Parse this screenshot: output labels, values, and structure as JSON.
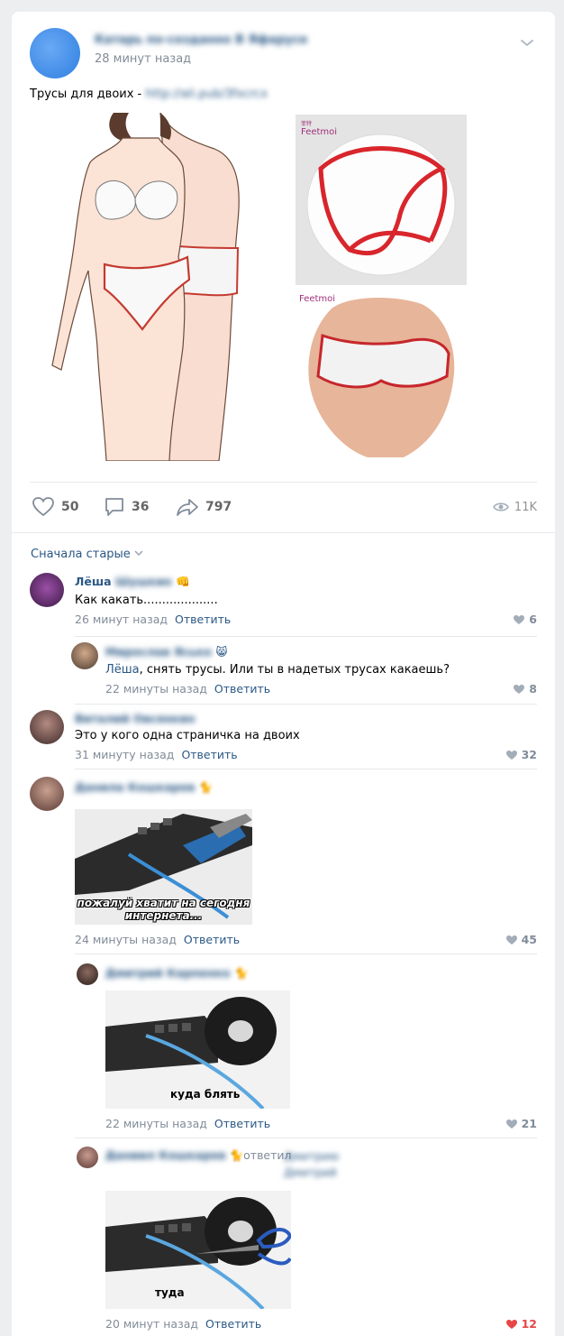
{
  "post": {
    "author": "Катарь по-созданно В Яфарусе",
    "time": "28 минут назад",
    "text": "Трусы для двоих - ",
    "link": "http://ali.pub/3fxcrcx",
    "menu_icon": "chevron-down-icon",
    "brand_logo": "Feetmoi"
  },
  "actions": {
    "likes": "50",
    "comments": "36",
    "shares": "797",
    "views": "11K"
  },
  "sort": {
    "label": "Сначала старые"
  },
  "comments": [
    {
      "name": "Лёша",
      "name_blur": "Шушкин",
      "emoji": "👊",
      "text": "Как какать....................",
      "time": "26 минут назад",
      "reply": "Ответить",
      "likes": "6"
    },
    {
      "name": "Мирослав Ясько",
      "emoji": "😸",
      "mention": "Лёша",
      "text": ", снять трусы. Или ты в надетых трусах какаешь?",
      "time": "22 минуты назад",
      "reply": "Ответить",
      "likes": "8"
    },
    {
      "name": "Виталий Овсянкин",
      "text": "Это у кого одна страничка на двоих",
      "time": "31 минуту назад",
      "reply": "Ответить",
      "likes": "32"
    },
    {
      "name": "Данила Кошкарев",
      "emoji": "🐈",
      "meme_caption": "пожалуй хватит на сегодня интернета...",
      "time": "24 минуты назад",
      "reply": "Ответить",
      "likes": "45"
    },
    {
      "name": "Дмитрий Карпенко",
      "emoji": "🐈",
      "meme_caption": "куда блять",
      "time": "22 минуты назад",
      "reply": "Ответить",
      "likes": "21"
    },
    {
      "name": "Даниил Кошкарев",
      "emoji": "🐈",
      "replied": "ответил",
      "replied_to": "Дмитрию Дмитрий",
      "meme_caption": "туда",
      "time": "20 минут назад",
      "reply": "Ответить",
      "likes": "12",
      "liked": true
    }
  ],
  "colors": {
    "link": "#2a5885",
    "meta": "#818c99",
    "like_active": "#e64646",
    "bg": "#edeef0"
  }
}
